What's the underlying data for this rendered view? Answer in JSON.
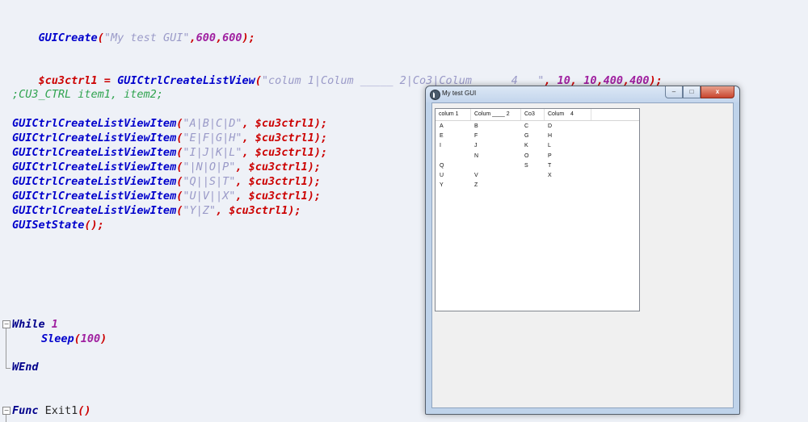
{
  "code": {
    "line_gui_create": {
      "fn": "GUICreate",
      "open": "(",
      "str": "\"My test GUI\"",
      "c1": ",",
      "n1": "600",
      "c2": ",",
      "n2": "600",
      "close": ");"
    },
    "line_listview": {
      "var": "$cu3ctrl1",
      "eq": " = ",
      "fn": "GUICtrlCreateListView",
      "open": "(",
      "str": "\"colum 1|Colum _____ 2|Co3|Colum      4   \"",
      "c1": ", ",
      "n1": "10",
      "c2": ", ",
      "n2": "10",
      "c3": ",",
      "n3": "400",
      "c4": ",",
      "n4": "400",
      "close": ");"
    },
    "comment": ";CU3_CTRL item1, item2;",
    "items": [
      {
        "fn": "GUICtrlCreateListViewItem",
        "str": "\"A|B|C|D\"",
        "var": "$cu3ctrl1"
      },
      {
        "fn": "GUICtrlCreateListViewItem",
        "str": "\"E|F|G|H\"",
        "var": "$cu3ctrl1"
      },
      {
        "fn": "GUICtrlCreateListViewItem",
        "str": "\"I|J|K|L\"",
        "var": "$cu3ctrl1"
      },
      {
        "fn": "GUICtrlCreateListViewItem",
        "str": "\"|N|O|P\"",
        "var": "$cu3ctrl1"
      },
      {
        "fn": "GUICtrlCreateListViewItem",
        "str": "\"Q||S|T\"",
        "var": "$cu3ctrl1"
      },
      {
        "fn": "GUICtrlCreateListViewItem",
        "str": "\"U|V||X\"",
        "var": "$cu3ctrl1"
      },
      {
        "fn": "GUICtrlCreateListViewItem",
        "str": "\"Y|Z\"",
        "var": "$cu3ctrl1"
      }
    ],
    "set_state": {
      "fn": "GUISetState",
      "paren": "()",
      "semi": ";"
    },
    "while_kw": "While",
    "while_num": "1",
    "sleep_fn": "Sleep",
    "sleep_num": "100",
    "wend": "WEnd",
    "func_kw": "Func",
    "func_name": "Exit1",
    "func_paren": "()"
  },
  "window": {
    "title": "My test GUI",
    "min_glyph": "–",
    "max_glyph": "□",
    "close_glyph": "x",
    "columns": [
      "colum 1",
      "Colum ____ 2",
      "Co3",
      "Colum    4"
    ],
    "rows": [
      [
        "A",
        "B",
        "C",
        "D"
      ],
      [
        "E",
        "F",
        "G",
        "H"
      ],
      [
        "I",
        "J",
        "K",
        "L"
      ],
      [
        "",
        "N",
        "O",
        "P"
      ],
      [
        "Q",
        "",
        "S",
        "T"
      ],
      [
        "U",
        "V",
        "",
        "X"
      ],
      [
        "Y",
        "Z",
        "",
        ""
      ]
    ]
  }
}
